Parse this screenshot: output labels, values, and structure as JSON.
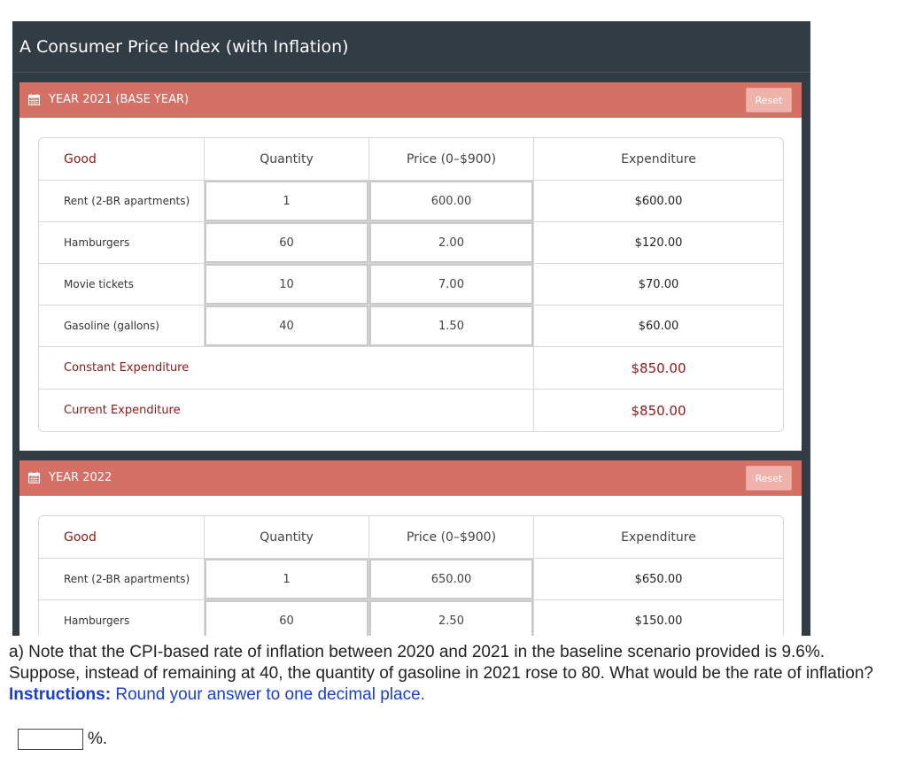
{
  "app": {
    "title": "A Consumer Price Index (with Inflation)"
  },
  "columns": {
    "good": "Good",
    "quantity": "Quantity",
    "price": "Price (0–$900)",
    "expenditure": "Expenditure"
  },
  "panels": [
    {
      "title": "YEAR 2021 (BASE YEAR)",
      "reset_label": "Reset",
      "rows": [
        {
          "good": "Rent (2-BR apartments)",
          "quantity": "1",
          "price": "600.00",
          "expenditure": "$600.00"
        },
        {
          "good": "Hamburgers",
          "quantity": "60",
          "price": "2.00",
          "expenditure": "$120.00"
        },
        {
          "good": "Movie tickets",
          "quantity": "10",
          "price": "7.00",
          "expenditure": "$70.00"
        },
        {
          "good": "Gasoline (gallons)",
          "quantity": "40",
          "price": "1.50",
          "expenditure": "$60.00"
        }
      ],
      "constant_label": "Constant Expenditure",
      "constant_value": "$850.00",
      "current_label": "Current Expenditure",
      "current_value": "$850.00"
    },
    {
      "title": "YEAR 2022",
      "reset_label": "Reset",
      "rows": [
        {
          "good": "Rent (2-BR apartments)",
          "quantity": "1",
          "price": "650.00",
          "expenditure": "$650.00"
        },
        {
          "good": "Hamburgers",
          "quantity": "60",
          "price": "2.50",
          "expenditure": "$150.00"
        }
      ]
    }
  ],
  "question": {
    "text": "a) Note that the CPI-based rate of inflation between 2020 and 2021 in the baseline scenario provided is 9.6%. Suppose, instead of remaining at 40, the quantity of gasoline in 2021 rose to 80. What would be the rate of inflation?",
    "instructions_label": "Instructions:",
    "instructions_text": "Round your answer to one decimal place.",
    "answer_value": "",
    "unit": "%."
  },
  "colors": {
    "frame": "#323c45",
    "panel_header": "#d57067",
    "accent_text": "#8b1a1a",
    "instruction_blue": "#1a3fd0"
  },
  "icons": {
    "panel_icon": "calendar-icon"
  }
}
